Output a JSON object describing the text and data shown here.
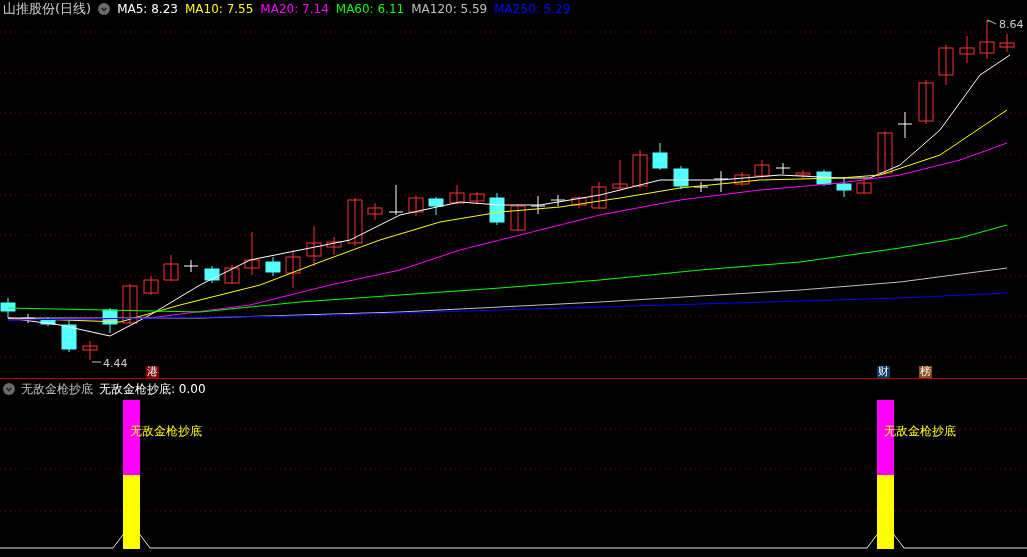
{
  "title": "山推股份(日线)",
  "ma_legend": [
    {
      "label": "MA5: 8.23",
      "color": "#ffffff"
    },
    {
      "label": "MA10: 7.55",
      "color": "#ffff00"
    },
    {
      "label": "MA20: 7.14",
      "color": "#ff00ff"
    },
    {
      "label": "MA60: 6.11",
      "color": "#00ff00"
    },
    {
      "label": "MA120: 5.59",
      "color": "#c0c0c0"
    },
    {
      "label": "MA250: 5.29",
      "color": "#0000ff"
    }
  ],
  "price_labels": {
    "high": "8.64",
    "low": "4.44"
  },
  "event_markers": [
    {
      "label": "港",
      "color": "#800000"
    },
    {
      "label": "财",
      "color": "#0a3a6a"
    },
    {
      "label": "榜",
      "color": "#8a4a14"
    }
  ],
  "indicator": {
    "name": "无敌金枪抄底",
    "value_label": "无敌金枪抄底: 0.00"
  },
  "signals": [
    {
      "label": "无敌金枪抄底"
    },
    {
      "label": "无敌金枪抄底"
    }
  ]
}
